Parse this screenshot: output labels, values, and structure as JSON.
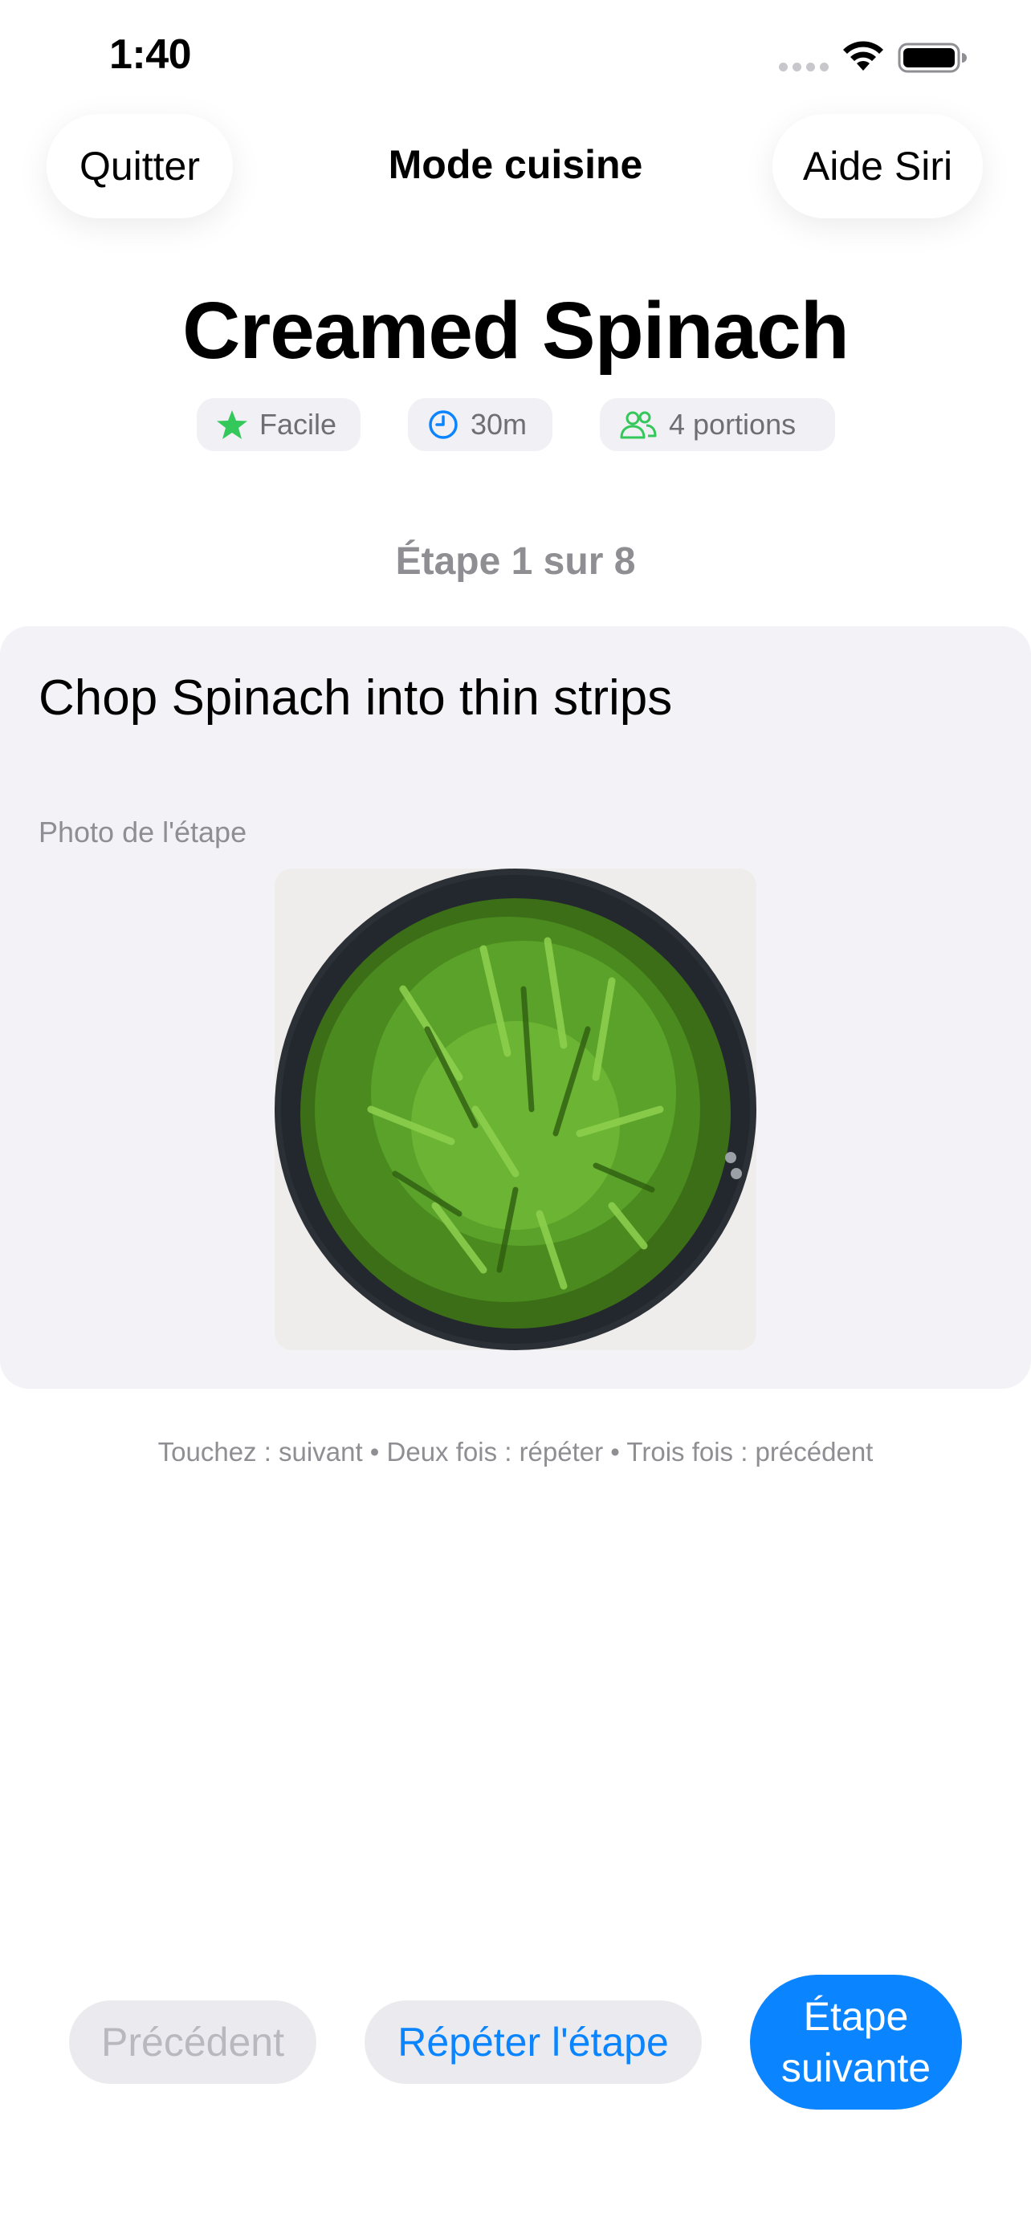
{
  "status_bar": {
    "time": "1:40",
    "icons": [
      "signal-icon",
      "wifi-icon",
      "battery-icon"
    ]
  },
  "nav": {
    "quit_label": "Quitter",
    "title": "Mode cuisine",
    "siri_label": "Aide Siri"
  },
  "recipe": {
    "title": "Creamed Spinach",
    "difficulty": "Facile",
    "time": "30m",
    "servings": "4 portions",
    "icons": [
      "star-icon",
      "clock-icon",
      "people-icon"
    ]
  },
  "step": {
    "indicator": "Étape 1 sur 8",
    "text": "Chop Spinach into thin strips",
    "photo_label": "Photo de l'étape"
  },
  "gesture_hint": "Touchez : suivant • Deux fois : répéter • Trois fois : précédent",
  "controls": {
    "previous_label": "Précédent",
    "repeat_label": "Répéter l'étape",
    "next_label": "Étape suivante",
    "previous_enabled": false
  },
  "colors": {
    "accent": "#0a84ff",
    "success": "#34c759",
    "card_background": "#f2f2f7",
    "secondary_text": "#8e8e93"
  }
}
